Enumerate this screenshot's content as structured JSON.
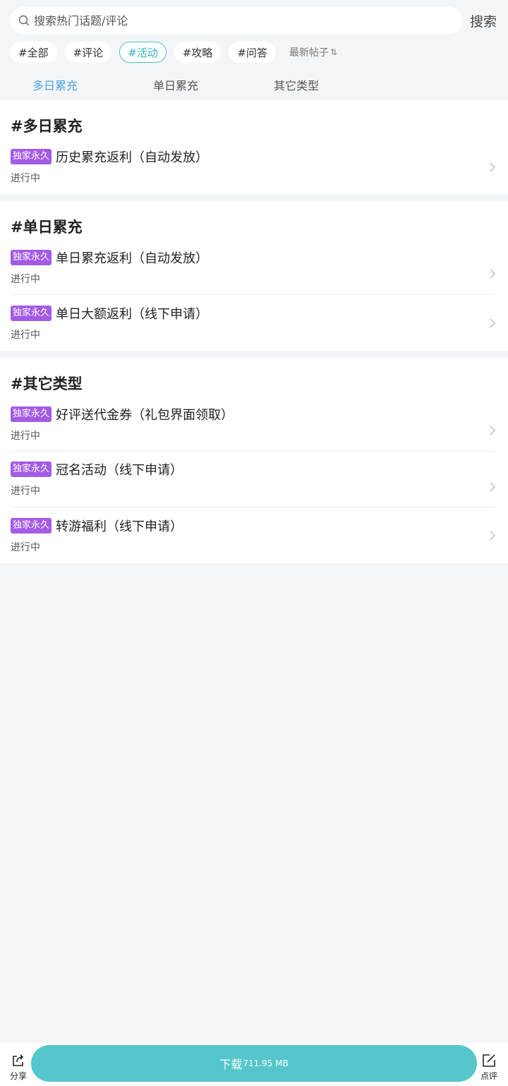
{
  "search": {
    "placeholder": "搜索热门话题/评论",
    "button_label": "搜索"
  },
  "tags": [
    {
      "label": "#全部",
      "active": false
    },
    {
      "label": "#评论",
      "active": false
    },
    {
      "label": "#活动",
      "active": true
    },
    {
      "label": "#攻略",
      "active": false
    },
    {
      "label": "#问答",
      "active": false
    }
  ],
  "sort": {
    "label": "最新帖子",
    "icon": "sort-arrows-icon"
  },
  "subtabs": [
    {
      "label": "多日累充",
      "active": true
    },
    {
      "label": "单日累充",
      "active": false
    },
    {
      "label": "其它类型",
      "active": false
    }
  ],
  "sections": [
    {
      "title": "#多日累充",
      "items": [
        {
          "badge": "独家永久",
          "title": "历史累充返利（自动发放）",
          "status": "进行中"
        }
      ]
    },
    {
      "title": "#单日累充",
      "items": [
        {
          "badge": "独家永久",
          "title": "单日累充返利（自动发放）",
          "status": "进行中"
        },
        {
          "badge": "独家永久",
          "title": "单日大额返利（线下申请）",
          "status": "进行中"
        }
      ]
    },
    {
      "title": "#其它类型",
      "items": [
        {
          "badge": "独家永久",
          "title": "好评送代金券（礼包界面领取）",
          "status": "进行中"
        },
        {
          "badge": "独家永久",
          "title": "冠名活动（线下申请）",
          "status": "进行中"
        },
        {
          "badge": "独家永久",
          "title": "转游福利（线下申请）",
          "status": "进行中"
        }
      ]
    }
  ],
  "bottom": {
    "share_label": "分享",
    "download_label": "下载",
    "download_size": "711.95 MB",
    "review_label": "点评"
  },
  "colors": {
    "accent": "#55c6cc",
    "badge": "#a35be6",
    "active_subtab": "#4aa3e6"
  }
}
